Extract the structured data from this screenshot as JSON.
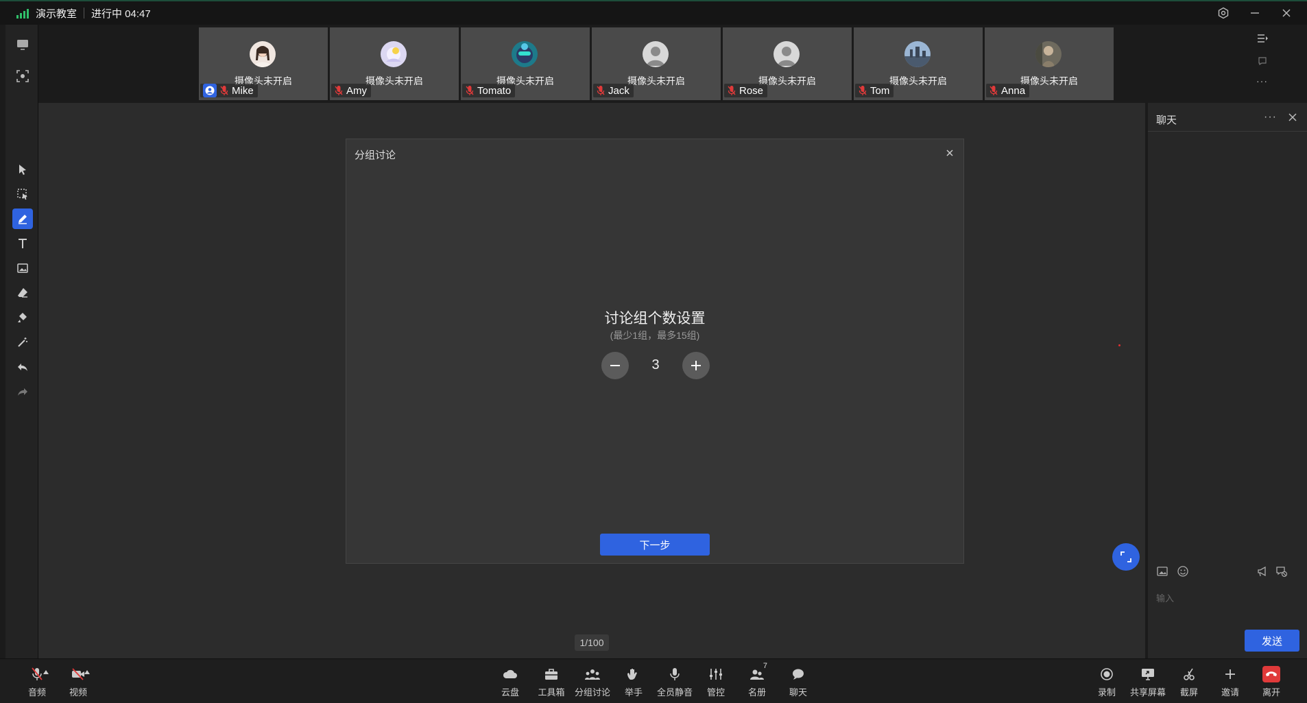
{
  "titlebar": {
    "room": "演示教室",
    "status": "进行中 04:47"
  },
  "participants": [
    {
      "name": "Mike",
      "cam": "摄像头未开启",
      "host": true
    },
    {
      "name": "Amy",
      "cam": "摄像头未开启"
    },
    {
      "name": "Tomato",
      "cam": "摄像头未开启"
    },
    {
      "name": "Jack",
      "cam": "摄像头未开启"
    },
    {
      "name": "Rose",
      "cam": "摄像头未开启"
    },
    {
      "name": "Tom",
      "cam": "摄像头未开启"
    },
    {
      "name": "Anna",
      "cam": "摄像头未开启"
    }
  ],
  "dialog": {
    "title": "分组讨论",
    "heading": "讨论组个数设置",
    "subtitle": "(最少1组，最多15组)",
    "group_count": "3",
    "next_label": "下一步"
  },
  "pager": "1/100",
  "chat": {
    "title": "聊天",
    "more": "···",
    "placeholder": "输入",
    "send_label": "发送"
  },
  "bottom": {
    "audio": "音频",
    "video": "视频",
    "cloud": "云盘",
    "toolbox": "工具箱",
    "breakout": "分组讨论",
    "raise_hand": "举手",
    "mute_all": "全员静音",
    "control": "管控",
    "roster": "名册",
    "roster_count": "7",
    "chat": "聊天",
    "record": "录制",
    "share": "共享屏幕",
    "screenshot": "截屏",
    "invite": "邀请",
    "leave": "离开"
  },
  "colors": {
    "accent": "#2f63e0",
    "danger": "#e03a3a",
    "signal": "#30c06a"
  }
}
